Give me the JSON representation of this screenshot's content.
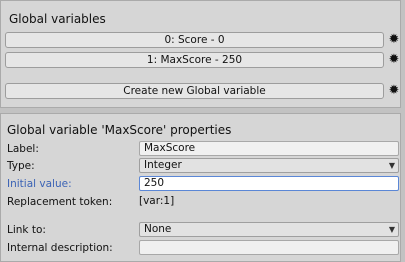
{
  "top_panel": {
    "title": "Global variables",
    "variables": [
      {
        "label": "0: Score - 0"
      },
      {
        "label": "1: MaxScore - 250"
      }
    ],
    "create_label": "Create new Global variable"
  },
  "props": {
    "title": "Global variable 'MaxScore' properties",
    "label_label": "Label:",
    "label_value": "MaxScore",
    "type_label": "Type:",
    "type_value": "Integer",
    "initial_label": "Initial value:",
    "initial_value": "250",
    "token_label": "Replacement token:",
    "token_value": "[var:1]",
    "link_label": "Link to:",
    "link_value": "None",
    "desc_label": "Internal description:",
    "desc_value": ""
  },
  "icons": {
    "gear": "gear-icon",
    "dropdown": "dropdown-arrow-icon"
  }
}
